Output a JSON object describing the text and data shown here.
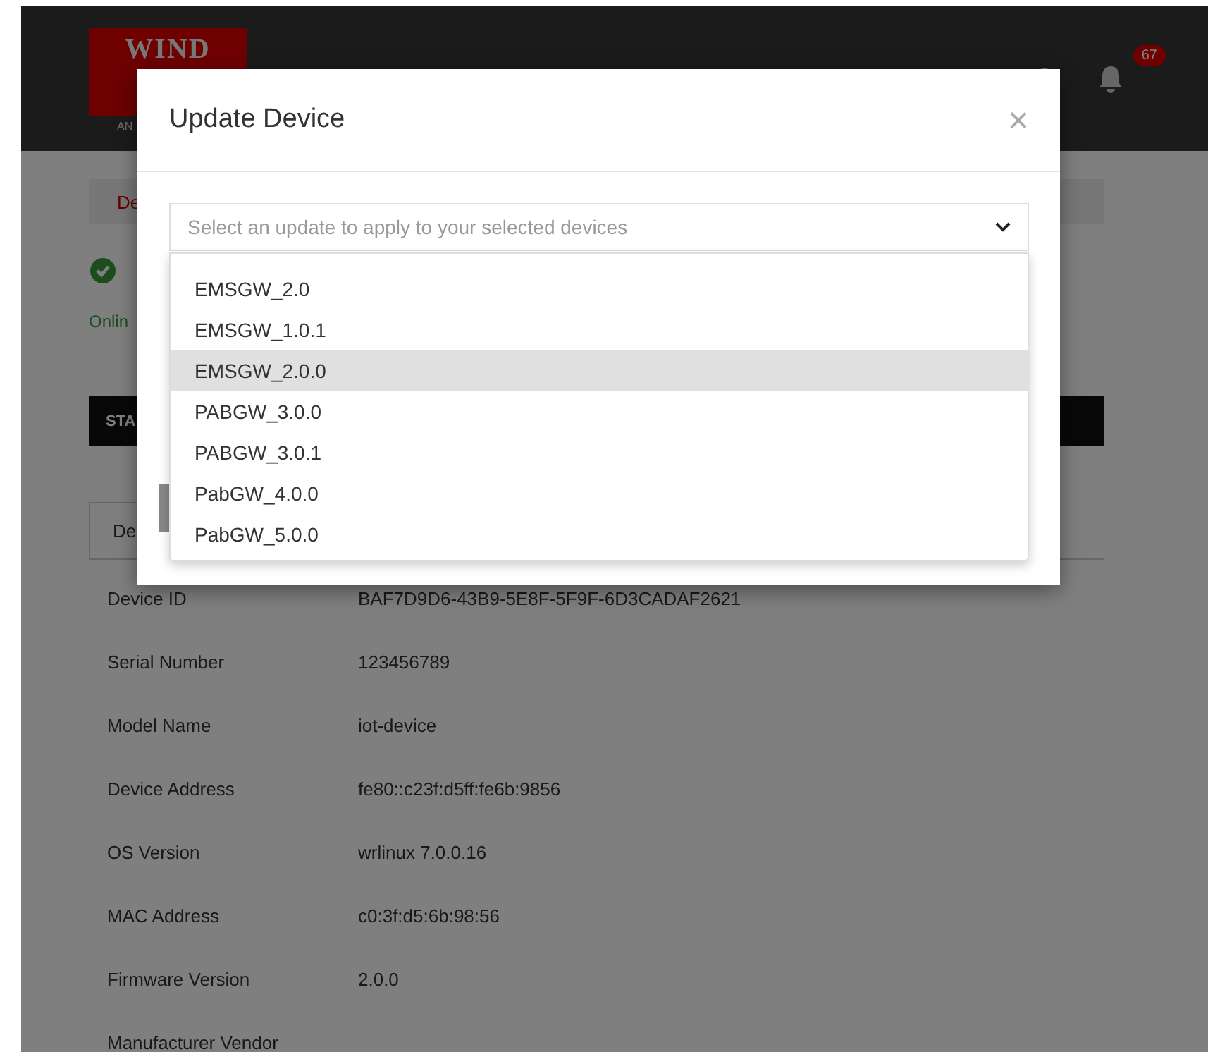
{
  "header": {
    "logo": "WIND",
    "tagline": "AN",
    "notification_count": "67"
  },
  "page": {
    "tab": "De",
    "status": "Onlin",
    "section_bar": "STA",
    "detail_tab": "De",
    "details": [
      {
        "label": "Device ID",
        "value": "BAF7D9D6-43B9-5E8F-5F9F-6D3CADAF2621"
      },
      {
        "label": "Serial Number",
        "value": "123456789"
      },
      {
        "label": "Model Name",
        "value": "iot-device"
      },
      {
        "label": "Device Address",
        "value": "fe80::c23f:d5ff:fe6b:9856"
      },
      {
        "label": "OS Version",
        "value": "wrlinux 7.0.0.16"
      },
      {
        "label": "MAC Address",
        "value": "c0:3f:d5:6b:98:56"
      },
      {
        "label": "Firmware Version",
        "value": "2.0.0"
      },
      {
        "label": "Manufacturer Vendor"
      }
    ]
  },
  "modal": {
    "title": "Update Device",
    "close": "×",
    "select": {
      "placeholder": "Select an update to apply to your selected devices",
      "expanded": true
    },
    "options": [
      {
        "label": "EMSGW_2.0",
        "selected": false
      },
      {
        "label": "EMSGW_1.0.1",
        "selected": false
      },
      {
        "label": "EMSGW_2.0.0",
        "selected": true
      },
      {
        "label": "PABGW_3.0.0",
        "selected": false
      },
      {
        "label": "PABGW_3.0.1",
        "selected": false
      },
      {
        "label": "PabGW_4.0.0",
        "selected": false
      },
      {
        "label": "PabGW_5.0.0",
        "selected": false
      }
    ]
  }
}
